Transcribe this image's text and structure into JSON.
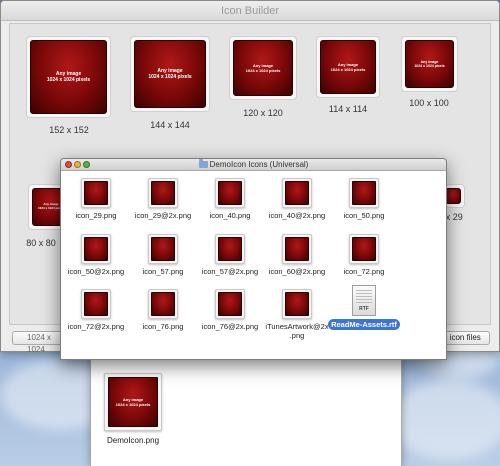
{
  "builder": {
    "title": "Icon Builder",
    "art_line1": "Any image",
    "art_line2": "1024 x 1024 pixels",
    "tiles": [
      {
        "label": "152 x 152"
      },
      {
        "label": "144 x 144"
      },
      {
        "label": "120 x 120"
      },
      {
        "label": "114 x 114"
      },
      {
        "label": "100 x 100"
      },
      {
        "label": "80 x 80"
      },
      {
        "label": "29 x 29"
      }
    ],
    "bottom_left": "1024 x 1024",
    "bottom_right": "e icon files"
  },
  "finder": {
    "title": "DemoIcon Icons (Universal)",
    "files": [
      "icon_29.png",
      "icon_29@2x.png",
      "icon_40.png",
      "icon_40@2x.png",
      "icon_50.png",
      "icon_50@2x.png",
      "icon_57.png",
      "icon_57@2x.png",
      "icon_60@2x.png",
      "icon_72.png",
      "icon_72@2x.png",
      "icon_76.png",
      "icon_76@2x.png",
      "iTunesArtwork@2x .png"
    ],
    "rtf_file": "ReadMe-Assets.rtf",
    "rtf_badge": "RTF"
  },
  "result": {
    "file": "DemoIcon.png"
  }
}
